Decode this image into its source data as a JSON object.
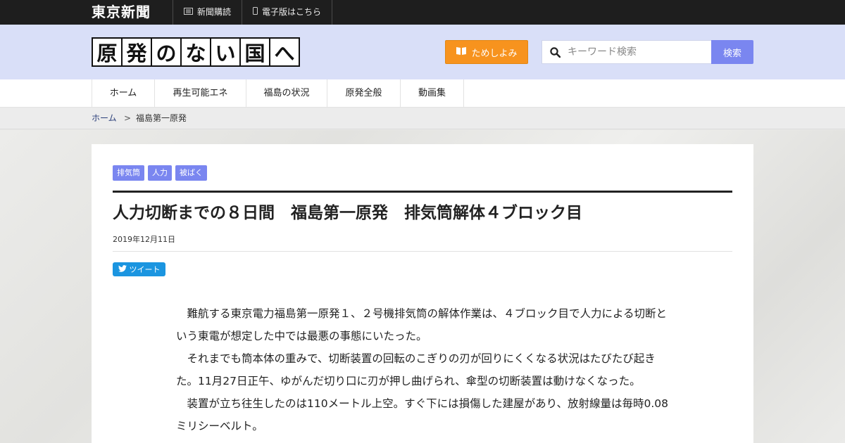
{
  "topbar": {
    "brand": "東京新聞",
    "links": [
      {
        "label": "新聞購読",
        "icon": "newspaper-icon"
      },
      {
        "label": "電子版はこちら",
        "icon": "phone-icon"
      }
    ]
  },
  "header": {
    "logo_chars": [
      "原",
      "発",
      "の",
      "な",
      "い",
      "国",
      "へ"
    ],
    "trial_label": "ためしよみ",
    "search_placeholder": "キーワード検索",
    "search_button": "検索"
  },
  "nav": {
    "items": [
      "ホーム",
      "再生可能エネ",
      "福島の状況",
      "原発全般",
      "動画集"
    ]
  },
  "breadcrumb": {
    "home": "ホーム",
    "separator": ">",
    "current": "福島第一原発"
  },
  "article": {
    "tags": [
      "排気筒",
      "人力",
      "被ばく"
    ],
    "title": "人力切断までの８日間　福島第一原発　排気筒解体４ブロック目",
    "date": "2019年12月11日",
    "tweet_label": "ツイート",
    "paragraphs": [
      "難航する東京電力福島第一原発１、２号機排気筒の解体作業は、４ブロック目で人力による切断という東電が想定した中では最悪の事態にいたった。",
      "それまでも筒本体の重みで、切断装置の回転のこぎりの刃が回りにくくなる状況はたびたび起きた。11月27日正午、ゆがんだ切り口に刃が押し曲げられ、傘型の切断装置は動けなくなった。",
      "装置が立ち往生したのは110メートル上空。すぐ下には損傷した建屋があり、放射線量は毎時0.08ミリシーベルト。"
    ]
  },
  "colors": {
    "topbar_bg": "#1e1e1e",
    "header_bg": "#d9dff8",
    "accent_orange": "#f7931e",
    "accent_blue": "#7a86f0",
    "twitter_blue": "#1b95e0"
  }
}
